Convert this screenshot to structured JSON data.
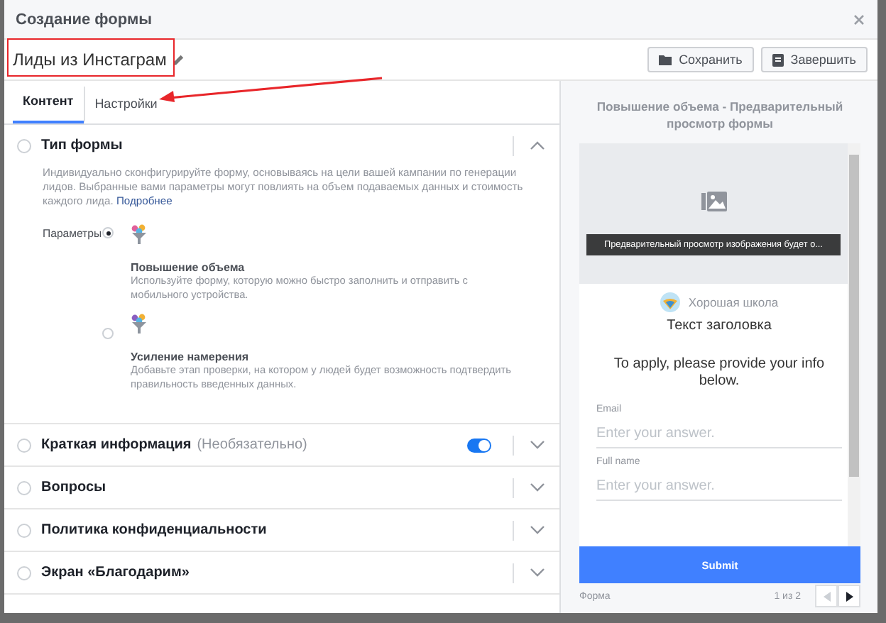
{
  "window": {
    "title": "Создание формы"
  },
  "form_name": "Лиды из Инстаграм",
  "buttons": [
    {
      "label": "Сохранить",
      "kind": "save"
    },
    {
      "label": "Завершить",
      "kind": "finish"
    }
  ],
  "tabs": [
    {
      "label": "Контент",
      "selected": true
    },
    {
      "label": "Настройки",
      "selected": false
    }
  ],
  "sections": [
    {
      "title": "Тип формы",
      "expanded": true,
      "description": "Индивидуально сконфигурируйте форму, основываясь на цели вашей кампании по генерации лидов. Выбранные вами параметры могут повлиять на объем подаваемых данных и стоимость каждого лида.",
      "link": "Подробнее",
      "options_label": "Параметры",
      "options": [
        {
          "title": "Повышение объема",
          "description": "Используйте форму, которую можно быстро заполнить и отправить с мобильного устройства.",
          "selected": true
        },
        {
          "title": "Усиление намерения",
          "description": "Добавьте этап проверки, на котором у людей будет возможность подтвердить правильность введенных данных.",
          "selected": false
        }
      ]
    },
    {
      "title": "Краткая информация",
      "note": "(Необязательно)",
      "expanded": false,
      "toggle_on": true
    },
    {
      "title": "Вопросы",
      "expanded": false
    },
    {
      "title": "Политика конфиденциальности",
      "expanded": false
    },
    {
      "title": "Экран «Благодарим»",
      "expanded": false
    }
  ],
  "preview": {
    "title": "Повышение объема - Предварительный просмотр формы",
    "image_caption": "Предварительный просмотр изображения будет о...",
    "brand": "Хорошая школа",
    "heading": "Текст заголовка",
    "intro": "To apply, please provide your info below.",
    "fields": [
      {
        "label": "Email",
        "placeholder": "Enter your answer."
      },
      {
        "label": "Full name",
        "placeholder": "Enter your answer."
      }
    ],
    "submit": "Submit",
    "footer_label": "Форма",
    "page": "1 из 2"
  }
}
